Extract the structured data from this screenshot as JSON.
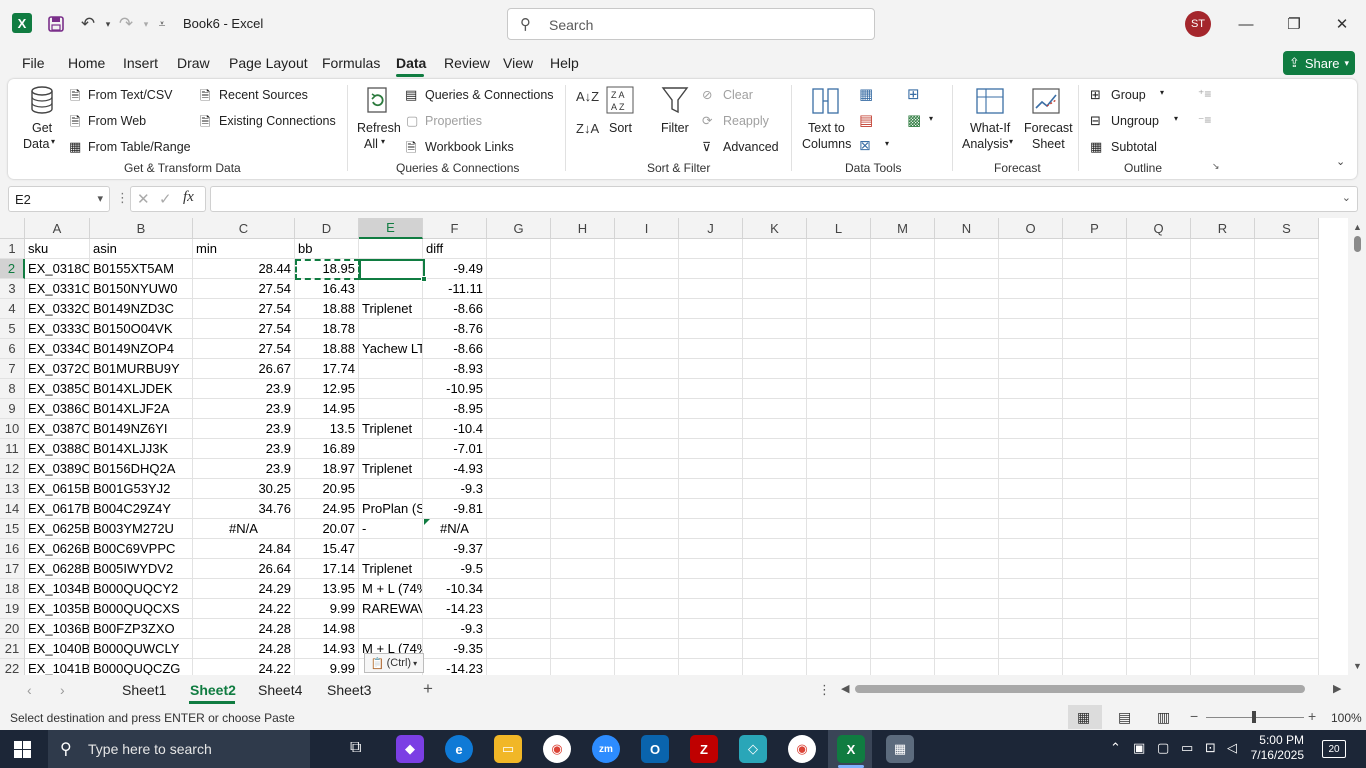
{
  "app": {
    "doc_title": "Book6  -  Excel",
    "search_placeholder": "Search",
    "user_initials": "ST",
    "share_label": "Share"
  },
  "menu": [
    "File",
    "Home",
    "Insert",
    "Draw",
    "Page Layout",
    "Formulas",
    "Data",
    "Review",
    "View",
    "Help"
  ],
  "ribbon": {
    "get_data": [
      "Get",
      "Data"
    ],
    "from_text_csv": "From Text/CSV",
    "from_web": "From Web",
    "from_table_range": "From Table/Range",
    "recent_sources": "Recent Sources",
    "existing_connections": "Existing Connections",
    "group_get_transform": "Get & Transform Data",
    "refresh_all": [
      "Refresh",
      "All"
    ],
    "queries_connections": "Queries & Connections",
    "properties": "Properties",
    "workbook_links": "Workbook Links",
    "group_queries": "Queries & Connections",
    "sort": "Sort",
    "filter": "Filter",
    "clear": "Clear",
    "reapply": "Reapply",
    "advanced": "Advanced",
    "group_sort_filter": "Sort & Filter",
    "text_to_columns": [
      "Text to",
      "Columns"
    ],
    "group_data_tools": "Data Tools",
    "what_if": [
      "What-If",
      "Analysis"
    ],
    "forecast_sheet": [
      "Forecast",
      "Sheet"
    ],
    "group_forecast": "Forecast",
    "group_btn": "Group",
    "ungroup": "Ungroup",
    "subtotal": "Subtotal",
    "group_outline": "Outline"
  },
  "formula_bar": {
    "name_box": "E2",
    "formula": ""
  },
  "columns": [
    "A",
    "B",
    "C",
    "D",
    "E",
    "F",
    "G",
    "H",
    "I",
    "J",
    "K",
    "L",
    "M",
    "N",
    "O",
    "P",
    "Q",
    "R",
    "S"
  ],
  "header_row": [
    "sku",
    "asin",
    "min",
    "bb",
    "",
    "diff"
  ],
  "rows": [
    {
      "n": "2",
      "a": "EX_0318C(",
      "b": "B0155XT5AM",
      "c": "28.44",
      "d": "18.95",
      "e": "",
      "f": "-9.49"
    },
    {
      "n": "3",
      "a": "EX_0331C(",
      "b": "B0150NYUW0",
      "c": "27.54",
      "d": "16.43",
      "e": "",
      "f": "-11.11"
    },
    {
      "n": "4",
      "a": "EX_0332C(",
      "b": "B0149NZD3C",
      "c": "27.54",
      "d": "18.88",
      "e": "Triplenet",
      "f": "-8.66"
    },
    {
      "n": "5",
      "a": "EX_0333C(",
      "b": "B0150O04VK",
      "c": "27.54",
      "d": "18.78",
      "e": "",
      "f": "-8.76"
    },
    {
      "n": "6",
      "a": "EX_0334C(",
      "b": "B0149NZOP4",
      "c": "27.54",
      "d": "18.88",
      "e": "Yachew LT",
      "f": "-8.66"
    },
    {
      "n": "7",
      "a": "EX_0372C(",
      "b": "B01MURBU9Y",
      "c": "26.67",
      "d": "17.74",
      "e": "",
      "f": "-8.93"
    },
    {
      "n": "8",
      "a": "EX_0385C(",
      "b": "B014XLJDEK",
      "c": "23.9",
      "d": "12.95",
      "e": "",
      "f": "-10.95"
    },
    {
      "n": "9",
      "a": "EX_0386C(",
      "b": "B014XLJF2A",
      "c": "23.9",
      "d": "14.95",
      "e": "",
      "f": "-8.95"
    },
    {
      "n": "10",
      "a": "EX_0387C(",
      "b": "B0149NZ6YI",
      "c": "23.9",
      "d": "13.5",
      "e": "Triplenet",
      "f": "-10.4"
    },
    {
      "n": "11",
      "a": "EX_0388C(",
      "b": "B014XLJJ3K",
      "c": "23.9",
      "d": "16.89",
      "e": "",
      "f": "-7.01"
    },
    {
      "n": "12",
      "a": "EX_0389C(",
      "b": "B0156DHQ2A",
      "c": "23.9",
      "d": "18.97",
      "e": "Triplenet",
      "f": "-4.93"
    },
    {
      "n": "13",
      "a": "EX_0615B(",
      "b": "B001G53YJ2",
      "c": "30.25",
      "d": "20.95",
      "e": "",
      "f": "-9.3"
    },
    {
      "n": "14",
      "a": "EX_0617B(",
      "b": "B004C29Z4Y",
      "c": "34.76",
      "d": "24.95",
      "e": "ProPlan (S",
      "f": "-9.81"
    },
    {
      "n": "15",
      "a": "EX_0625B(",
      "b": "B003YM272U",
      "c": "#N/A",
      "d": "20.07",
      "e": "-",
      "f": "#N/A"
    },
    {
      "n": "16",
      "a": "EX_0626B(",
      "b": "B00C69VPPC",
      "c": "24.84",
      "d": "15.47",
      "e": "",
      "f": "-9.37"
    },
    {
      "n": "17",
      "a": "EX_0628B(",
      "b": "B005IWYDV2",
      "c": "26.64",
      "d": "17.14",
      "e": "Triplenet",
      "f": "-9.5"
    },
    {
      "n": "18",
      "a": "EX_1034B(",
      "b": "B000QUQCY2",
      "c": "24.29",
      "d": "13.95",
      "e": "M + L (74%",
      "f": "-10.34"
    },
    {
      "n": "19",
      "a": "EX_1035B(",
      "b": "B000QUQCXS",
      "c": "24.22",
      "d": "9.99",
      "e": "RAREWAV",
      "f": "-14.23"
    },
    {
      "n": "20",
      "a": "EX_1036B(",
      "b": "B00FZP3ZXO",
      "c": "24.28",
      "d": "14.98",
      "e": "",
      "f": "-9.3"
    },
    {
      "n": "21",
      "a": "EX_1040B(",
      "b": "B000QUWCLY",
      "c": "24.28",
      "d": "14.93",
      "e": "M + L (74%",
      "f": "-9.35"
    },
    {
      "n": "22",
      "a": "EX_1041B(",
      "b": "B000QUQCZG",
      "c": "24.22",
      "d": "9.99",
      "e": "",
      "f": "-14.23"
    }
  ],
  "paste_options": "(Ctrl)",
  "sheets": [
    "Sheet1",
    "Sheet2",
    "Sheet4",
    "Sheet3"
  ],
  "active_sheet": "Sheet2",
  "status": {
    "message": "Select destination and press ENTER or choose Paste",
    "zoom": "100%"
  },
  "taskbar": {
    "search_placeholder": "Type here to search",
    "time": "5:00 PM",
    "date": "7/16/2025",
    "notifications": "20"
  },
  "colors": {
    "excel_green": "#107c41",
    "avatar": "#a4262c",
    "taskbar": "#1c2637"
  }
}
